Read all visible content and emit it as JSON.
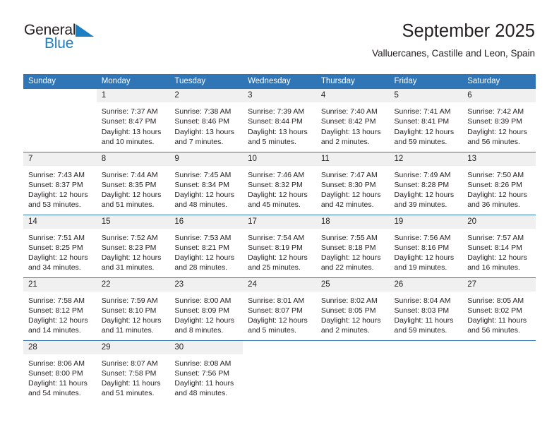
{
  "brand": {
    "name_part1": "General",
    "name_part2": "Blue",
    "triangle_color": "#1c7fc4"
  },
  "header": {
    "title": "September 2025",
    "subtitle": "Valluercanes, Castille and Leon, Spain"
  },
  "theme": {
    "header_bg": "#3075b6",
    "daynum_bg": "#f0f0f0",
    "text": "#231f20",
    "accent": "#1c7fc4"
  },
  "weekday_headers": [
    "Sunday",
    "Monday",
    "Tuesday",
    "Wednesday",
    "Thursday",
    "Friday",
    "Saturday"
  ],
  "weeks": [
    [
      {
        "day": "",
        "sunrise": "",
        "sunset": "",
        "daylight1": "",
        "daylight2": ""
      },
      {
        "day": "1",
        "sunrise": "Sunrise: 7:37 AM",
        "sunset": "Sunset: 8:47 PM",
        "daylight1": "Daylight: 13 hours",
        "daylight2": "and 10 minutes."
      },
      {
        "day": "2",
        "sunrise": "Sunrise: 7:38 AM",
        "sunset": "Sunset: 8:46 PM",
        "daylight1": "Daylight: 13 hours",
        "daylight2": "and 7 minutes."
      },
      {
        "day": "3",
        "sunrise": "Sunrise: 7:39 AM",
        "sunset": "Sunset: 8:44 PM",
        "daylight1": "Daylight: 13 hours",
        "daylight2": "and 5 minutes."
      },
      {
        "day": "4",
        "sunrise": "Sunrise: 7:40 AM",
        "sunset": "Sunset: 8:42 PM",
        "daylight1": "Daylight: 13 hours",
        "daylight2": "and 2 minutes."
      },
      {
        "day": "5",
        "sunrise": "Sunrise: 7:41 AM",
        "sunset": "Sunset: 8:41 PM",
        "daylight1": "Daylight: 12 hours",
        "daylight2": "and 59 minutes."
      },
      {
        "day": "6",
        "sunrise": "Sunrise: 7:42 AM",
        "sunset": "Sunset: 8:39 PM",
        "daylight1": "Daylight: 12 hours",
        "daylight2": "and 56 minutes."
      }
    ],
    [
      {
        "day": "7",
        "sunrise": "Sunrise: 7:43 AM",
        "sunset": "Sunset: 8:37 PM",
        "daylight1": "Daylight: 12 hours",
        "daylight2": "and 53 minutes."
      },
      {
        "day": "8",
        "sunrise": "Sunrise: 7:44 AM",
        "sunset": "Sunset: 8:35 PM",
        "daylight1": "Daylight: 12 hours",
        "daylight2": "and 51 minutes."
      },
      {
        "day": "9",
        "sunrise": "Sunrise: 7:45 AM",
        "sunset": "Sunset: 8:34 PM",
        "daylight1": "Daylight: 12 hours",
        "daylight2": "and 48 minutes."
      },
      {
        "day": "10",
        "sunrise": "Sunrise: 7:46 AM",
        "sunset": "Sunset: 8:32 PM",
        "daylight1": "Daylight: 12 hours",
        "daylight2": "and 45 minutes."
      },
      {
        "day": "11",
        "sunrise": "Sunrise: 7:47 AM",
        "sunset": "Sunset: 8:30 PM",
        "daylight1": "Daylight: 12 hours",
        "daylight2": "and 42 minutes."
      },
      {
        "day": "12",
        "sunrise": "Sunrise: 7:49 AM",
        "sunset": "Sunset: 8:28 PM",
        "daylight1": "Daylight: 12 hours",
        "daylight2": "and 39 minutes."
      },
      {
        "day": "13",
        "sunrise": "Sunrise: 7:50 AM",
        "sunset": "Sunset: 8:26 PM",
        "daylight1": "Daylight: 12 hours",
        "daylight2": "and 36 minutes."
      }
    ],
    [
      {
        "day": "14",
        "sunrise": "Sunrise: 7:51 AM",
        "sunset": "Sunset: 8:25 PM",
        "daylight1": "Daylight: 12 hours",
        "daylight2": "and 34 minutes."
      },
      {
        "day": "15",
        "sunrise": "Sunrise: 7:52 AM",
        "sunset": "Sunset: 8:23 PM",
        "daylight1": "Daylight: 12 hours",
        "daylight2": "and 31 minutes."
      },
      {
        "day": "16",
        "sunrise": "Sunrise: 7:53 AM",
        "sunset": "Sunset: 8:21 PM",
        "daylight1": "Daylight: 12 hours",
        "daylight2": "and 28 minutes."
      },
      {
        "day": "17",
        "sunrise": "Sunrise: 7:54 AM",
        "sunset": "Sunset: 8:19 PM",
        "daylight1": "Daylight: 12 hours",
        "daylight2": "and 25 minutes."
      },
      {
        "day": "18",
        "sunrise": "Sunrise: 7:55 AM",
        "sunset": "Sunset: 8:18 PM",
        "daylight1": "Daylight: 12 hours",
        "daylight2": "and 22 minutes."
      },
      {
        "day": "19",
        "sunrise": "Sunrise: 7:56 AM",
        "sunset": "Sunset: 8:16 PM",
        "daylight1": "Daylight: 12 hours",
        "daylight2": "and 19 minutes."
      },
      {
        "day": "20",
        "sunrise": "Sunrise: 7:57 AM",
        "sunset": "Sunset: 8:14 PM",
        "daylight1": "Daylight: 12 hours",
        "daylight2": "and 16 minutes."
      }
    ],
    [
      {
        "day": "21",
        "sunrise": "Sunrise: 7:58 AM",
        "sunset": "Sunset: 8:12 PM",
        "daylight1": "Daylight: 12 hours",
        "daylight2": "and 14 minutes."
      },
      {
        "day": "22",
        "sunrise": "Sunrise: 7:59 AM",
        "sunset": "Sunset: 8:10 PM",
        "daylight1": "Daylight: 12 hours",
        "daylight2": "and 11 minutes."
      },
      {
        "day": "23",
        "sunrise": "Sunrise: 8:00 AM",
        "sunset": "Sunset: 8:09 PM",
        "daylight1": "Daylight: 12 hours",
        "daylight2": "and 8 minutes."
      },
      {
        "day": "24",
        "sunrise": "Sunrise: 8:01 AM",
        "sunset": "Sunset: 8:07 PM",
        "daylight1": "Daylight: 12 hours",
        "daylight2": "and 5 minutes."
      },
      {
        "day": "25",
        "sunrise": "Sunrise: 8:02 AM",
        "sunset": "Sunset: 8:05 PM",
        "daylight1": "Daylight: 12 hours",
        "daylight2": "and 2 minutes."
      },
      {
        "day": "26",
        "sunrise": "Sunrise: 8:04 AM",
        "sunset": "Sunset: 8:03 PM",
        "daylight1": "Daylight: 11 hours",
        "daylight2": "and 59 minutes."
      },
      {
        "day": "27",
        "sunrise": "Sunrise: 8:05 AM",
        "sunset": "Sunset: 8:02 PM",
        "daylight1": "Daylight: 11 hours",
        "daylight2": "and 56 minutes."
      }
    ],
    [
      {
        "day": "28",
        "sunrise": "Sunrise: 8:06 AM",
        "sunset": "Sunset: 8:00 PM",
        "daylight1": "Daylight: 11 hours",
        "daylight2": "and 54 minutes."
      },
      {
        "day": "29",
        "sunrise": "Sunrise: 8:07 AM",
        "sunset": "Sunset: 7:58 PM",
        "daylight1": "Daylight: 11 hours",
        "daylight2": "and 51 minutes."
      },
      {
        "day": "30",
        "sunrise": "Sunrise: 8:08 AM",
        "sunset": "Sunset: 7:56 PM",
        "daylight1": "Daylight: 11 hours",
        "daylight2": "and 48 minutes."
      },
      {
        "day": "",
        "sunrise": "",
        "sunset": "",
        "daylight1": "",
        "daylight2": ""
      },
      {
        "day": "",
        "sunrise": "",
        "sunset": "",
        "daylight1": "",
        "daylight2": ""
      },
      {
        "day": "",
        "sunrise": "",
        "sunset": "",
        "daylight1": "",
        "daylight2": ""
      },
      {
        "day": "",
        "sunrise": "",
        "sunset": "",
        "daylight1": "",
        "daylight2": ""
      }
    ]
  ]
}
